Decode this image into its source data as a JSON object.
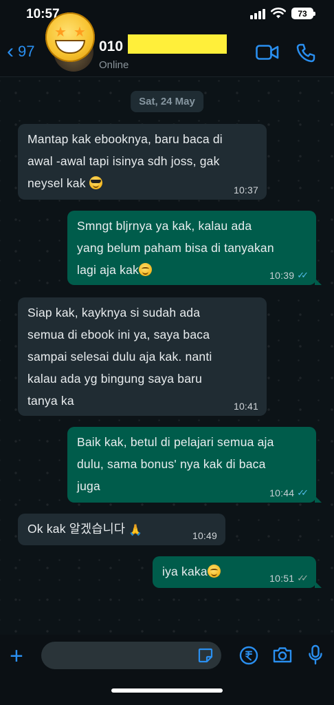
{
  "status_bar": {
    "time": "10:57",
    "battery": "73"
  },
  "header": {
    "back_count": "97",
    "contact_name_visible": "010",
    "contact_status": "Online"
  },
  "chat": {
    "date_label": "Sat, 24 May",
    "messages": [
      {
        "direction": "in",
        "lines": [
          "Mantap kak ebooknya, baru baca di",
          "awal -awal tapi isinya sdh joss, gak",
          "neysel kak"
        ],
        "time": "10:37",
        "emoji": "sunglasses"
      },
      {
        "direction": "out",
        "lines": [
          "Smngt bljrnya ya kak, kalau ada",
          "yang belum paham bisa di tanyakan",
          "lagi aja kak"
        ],
        "time": "10:39",
        "emoji": "smile",
        "status": "read"
      },
      {
        "direction": "in",
        "lines": [
          "Siap kak, kayknya si sudah ada",
          "semua di ebook ini ya, saya baca",
          "sampai selesai dulu aja kak. nanti",
          "kalau ada yg bingung saya baru",
          "tanya ka"
        ],
        "time": "10:41"
      },
      {
        "direction": "out",
        "lines": [
          "Baik kak, betul di pelajari semua aja",
          "dulu, sama bonus' nya kak di baca",
          "juga"
        ],
        "time": "10:44",
        "status": "read"
      },
      {
        "direction": "in",
        "lines": [
          "Ok kak 알겠습니다"
        ],
        "time": "10:49",
        "emoji": "pray"
      },
      {
        "direction": "out",
        "lines": [
          "iya kaka"
        ],
        "time": "10:51",
        "emoji": "smile",
        "status": "delivered"
      }
    ]
  },
  "colors": {
    "accent": "#2a8ff0",
    "incoming_bubble": "#202c33",
    "outgoing_bubble": "#005c4b",
    "read_ticks": "#53bdeb"
  },
  "icons": [
    "back-chevron-icon",
    "video-call-icon",
    "phone-call-icon",
    "plus-icon",
    "sticker-icon",
    "rupee-icon",
    "camera-icon",
    "microphone-icon"
  ]
}
